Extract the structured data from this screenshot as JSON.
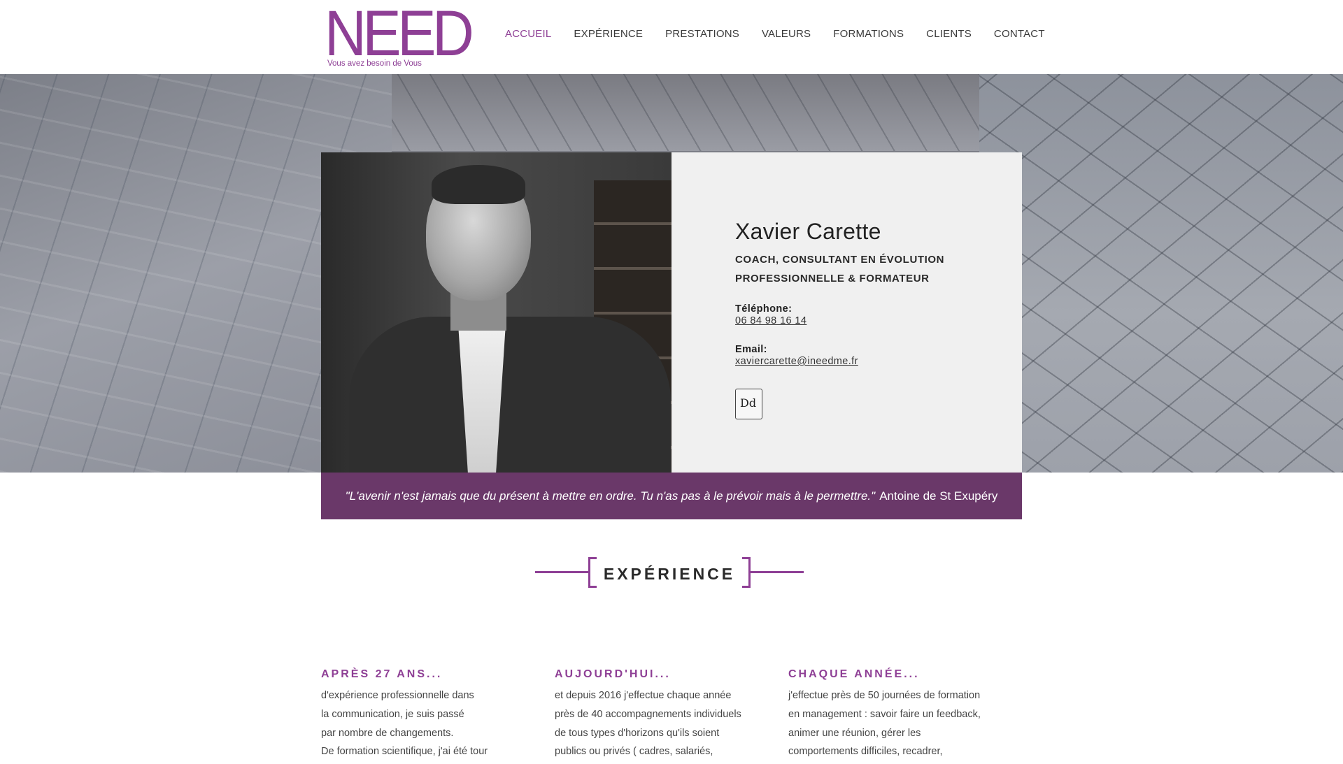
{
  "brand": {
    "logo_text": "NEED",
    "tagline": "Vous avez besoin de Vous",
    "accent_color": "#8e3f95",
    "quote_bar_color": "#6a3869"
  },
  "nav": {
    "items": [
      {
        "label": "ACCUEIL",
        "active": true
      },
      {
        "label": "EXPÉRIENCE",
        "active": false
      },
      {
        "label": "PRESTATIONS",
        "active": false
      },
      {
        "label": "VALEURS",
        "active": false
      },
      {
        "label": "FORMATIONS",
        "active": false
      },
      {
        "label": "CLIENTS",
        "active": false
      },
      {
        "label": "CONTACT",
        "active": false
      }
    ]
  },
  "profile": {
    "name": "Xavier Carette",
    "role_line1": "COACH, CONSULTANT EN ÉVOLUTION",
    "role_line2": "PROFESSIONNELLE & FORMATEUR",
    "phone_label": "Téléphone:",
    "phone": "06 84 98 16 14",
    "email_label": "Email:",
    "email": "xaviercarette@ineedme.fr",
    "badge_icon": "datadock-badge-icon",
    "badge_text": "Dd"
  },
  "quote": {
    "text": "\"L'avenir n'est jamais que du présent à mettre en ordre. Tu n'as pas à le prévoir mais à le permettre.\"",
    "author": "Antoine de St Exupéry"
  },
  "experience": {
    "heading": "EXPÉRIENCE",
    "columns": [
      {
        "title": "APRÈS 27 ANS...",
        "lines": [
          "d'expérience professionnelle dans",
          "la communication, je suis passé",
          "par nombre de changements.",
          "De formation scientifique, j'ai été tour"
        ]
      },
      {
        "title": "AUJOURD'HUI...",
        "lines": [
          "et depuis 2016 j'effectue chaque année",
          "près de 40 accompagnements individuels",
          "de tous types d'horizons qu'ils soient",
          "publics ou privés ( cadres, salariés,"
        ]
      },
      {
        "title": "CHAQUE ANNÉE...",
        "lines": [
          "j'effectue près de 50 journées de formation",
          "en management : savoir faire un feedback,",
          "animer une réunion, gérer les",
          "comportements difficiles, recadrer,"
        ]
      }
    ]
  }
}
